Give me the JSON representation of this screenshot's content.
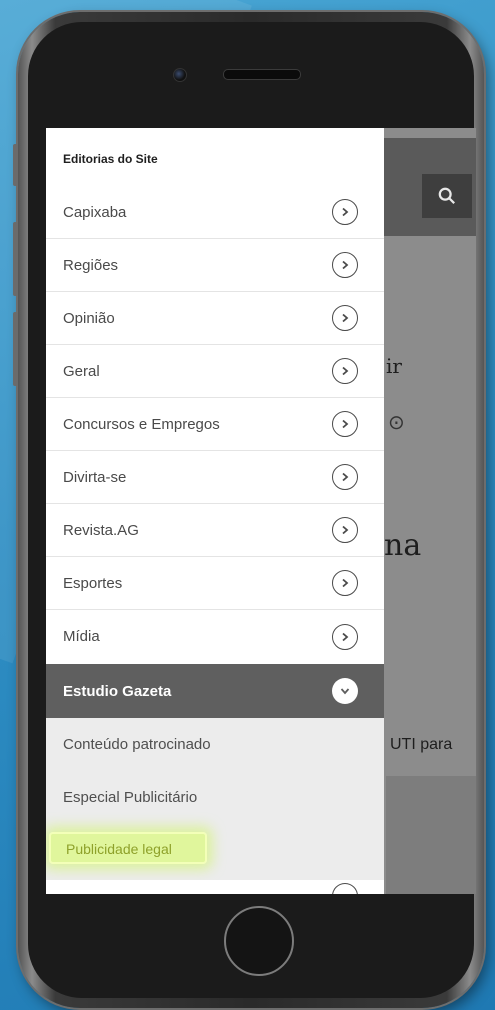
{
  "drawer": {
    "title": "Editorias do Site",
    "items": [
      {
        "label": "Capixaba"
      },
      {
        "label": "Regiões"
      },
      {
        "label": "Opinião"
      },
      {
        "label": "Geral"
      },
      {
        "label": "Concursos e Empregos"
      },
      {
        "label": "Divirta-se"
      },
      {
        "label": "Revista.AG"
      },
      {
        "label": "Esportes"
      },
      {
        "label": "Mídia"
      }
    ],
    "expanded_section": {
      "label": "Estudio Gazeta",
      "subitems": [
        {
          "label": "Conteúdo patrocinado"
        },
        {
          "label": "Especial Publicitário"
        },
        {
          "label": "Publicidade legal",
          "highlighted": true
        }
      ]
    }
  },
  "background_page": {
    "text_fragments": [
      "ir",
      "na",
      "UTI para"
    ]
  },
  "colors": {
    "section_bg": "#5f5f5f",
    "highlight": "#dffa82",
    "background_gradient_start": "#4aa6d4"
  },
  "icons": [
    "search-icon",
    "chevron-right-icon",
    "chevron-down-icon",
    "camera",
    "home-button"
  ]
}
